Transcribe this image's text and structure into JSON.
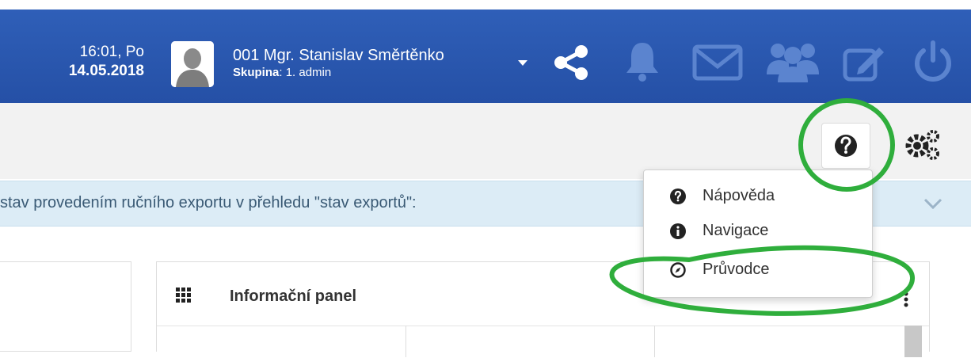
{
  "header": {
    "time": "16:01, Po",
    "date": "14.05.2018",
    "user_name": "001 Mgr. Stanislav Směrtěnko",
    "group_label": "Skupina",
    "group_value": ": 1. admin",
    "icons": [
      "share-icon",
      "bell-icon",
      "mail-icon",
      "users-icon",
      "edit-icon",
      "power-icon"
    ]
  },
  "info_bar": {
    "text": "stav provedením ručního exportu v přehledu \"stav exportů\":"
  },
  "panel": {
    "title": "Informační panel"
  },
  "help_menu": {
    "items": [
      {
        "label": "Nápověda",
        "icon": "question-circle-icon"
      },
      {
        "label": "Navigace",
        "icon": "info-circle-icon"
      },
      {
        "label": "Průvodce",
        "icon": "compass-icon"
      }
    ]
  },
  "colors": {
    "header_bg": "#2f5fb8",
    "annotation": "#2fae3c",
    "info_bg": "#dcecf6"
  }
}
